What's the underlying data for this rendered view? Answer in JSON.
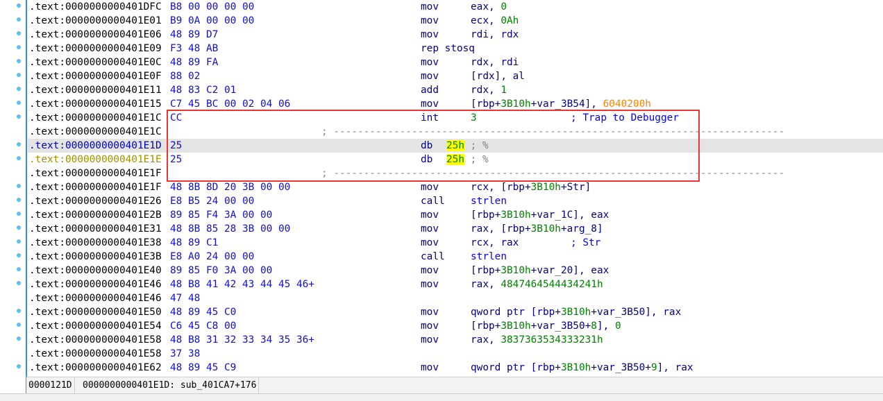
{
  "rows": [
    {
      "addr": ".text:0000000000401DFC",
      "bytes": "B8 00 00 00 00",
      "mn": "mov",
      "ops": [
        [
          "eax, ",
          "reg"
        ],
        [
          "0",
          "num"
        ]
      ],
      "bullet": true
    },
    {
      "addr": ".text:0000000000401E01",
      "bytes": "B9 0A 00 00 00",
      "mn": "mov",
      "ops": [
        [
          "ecx, ",
          "reg"
        ],
        [
          "0Ah",
          "num"
        ]
      ],
      "bullet": true
    },
    {
      "addr": ".text:0000000000401E06",
      "bytes": "48 89 D7",
      "mn": "mov",
      "ops": [
        [
          "rdi, rdx",
          "reg"
        ]
      ],
      "bullet": true
    },
    {
      "addr": ".text:0000000000401E09",
      "bytes": "F3 48 AB",
      "mn": "rep stosq",
      "ops": [],
      "bullet": true
    },
    {
      "addr": ".text:0000000000401E0C",
      "bytes": "48 89 FA",
      "mn": "mov",
      "ops": [
        [
          "rdx, rdi",
          "reg"
        ]
      ],
      "bullet": true
    },
    {
      "addr": ".text:0000000000401E0F",
      "bytes": "88 02",
      "mn": "mov",
      "ops": [
        [
          "[rdx], al",
          "reg"
        ]
      ],
      "bullet": true
    },
    {
      "addr": ".text:0000000000401E11",
      "bytes": "48 83 C2 01",
      "mn": "add",
      "ops": [
        [
          "rdx, ",
          "reg"
        ],
        [
          "1",
          "num"
        ]
      ],
      "bullet": true
    },
    {
      "addr": ".text:0000000000401E15",
      "bytes": "C7 45 BC 00 02 04 06",
      "mn": "mov",
      "ops": [
        [
          "[rbp+",
          "reg"
        ],
        [
          "3B10h",
          "num"
        ],
        [
          "+var_3B54], ",
          "reg"
        ],
        [
          "6040200h",
          "orange"
        ]
      ],
      "bullet": true
    },
    {
      "addr": ".text:0000000000401E1C",
      "bytes": "CC",
      "mn": "int",
      "ops": [
        [
          "3",
          "num"
        ]
      ],
      "comment": "; Trap to Debugger",
      "bullet": true
    },
    {
      "addr": ".text:0000000000401E1C",
      "sep": true
    },
    {
      "addr": ".text:0000000000401E1D",
      "bytes": "25",
      "db": "25h",
      "dbcmt": "; %",
      "bullet": true,
      "selected": true,
      "addrColor": "blue"
    },
    {
      "addr": ".text:0000000000401E1E",
      "bytes": "25",
      "db": "25h",
      "dbcmt": "; %",
      "bullet": true,
      "addrColor": "olive"
    },
    {
      "addr": ".text:0000000000401E1F",
      "sep": true
    },
    {
      "addr": ".text:0000000000401E1F",
      "bytes": "48 8B 8D 20 3B 00 00",
      "mn": "mov",
      "ops": [
        [
          "rcx, [rbp+",
          "reg"
        ],
        [
          "3B10h",
          "num"
        ],
        [
          "+Str]",
          "reg"
        ]
      ],
      "bullet": true
    },
    {
      "addr": ".text:0000000000401E26",
      "bytes": "E8 B5 24 00 00",
      "mn": "call",
      "ops": [
        [
          "strlen",
          "name"
        ]
      ],
      "bullet": true
    },
    {
      "addr": ".text:0000000000401E2B",
      "bytes": "89 85 F4 3A 00 00",
      "mn": "mov",
      "ops": [
        [
          "[rbp+",
          "reg"
        ],
        [
          "3B10h",
          "num"
        ],
        [
          "+var_1C], eax",
          "reg"
        ]
      ],
      "bullet": true
    },
    {
      "addr": ".text:0000000000401E31",
      "bytes": "48 8B 85 28 3B 00 00",
      "mn": "mov",
      "ops": [
        [
          "rax, [rbp+",
          "reg"
        ],
        [
          "3B10h",
          "num"
        ],
        [
          "+arg_8]",
          "reg"
        ]
      ],
      "bullet": true
    },
    {
      "addr": ".text:0000000000401E38",
      "bytes": "48 89 C1",
      "mn": "mov",
      "ops": [
        [
          "rcx, rax",
          "reg"
        ]
      ],
      "comment": "; Str",
      "bullet": true
    },
    {
      "addr": ".text:0000000000401E3B",
      "bytes": "E8 A0 24 00 00",
      "mn": "call",
      "ops": [
        [
          "strlen",
          "name"
        ]
      ],
      "bullet": true
    },
    {
      "addr": ".text:0000000000401E40",
      "bytes": "89 85 F0 3A 00 00",
      "mn": "mov",
      "ops": [
        [
          "[rbp+",
          "reg"
        ],
        [
          "3B10h",
          "num"
        ],
        [
          "+var_20], eax",
          "reg"
        ]
      ],
      "bullet": true
    },
    {
      "addr": ".text:0000000000401E46",
      "bytes": "48 B8 41 42 43 44 45 46+",
      "mn": "mov",
      "ops": [
        [
          "rax, ",
          "reg"
        ],
        [
          "4847464544434241h",
          "num"
        ]
      ],
      "bullet": true
    },
    {
      "addr": ".text:0000000000401E46",
      "bytes": "47 48"
    },
    {
      "addr": ".text:0000000000401E50",
      "bytes": "48 89 45 C0",
      "mn": "mov",
      "ops": [
        [
          "qword ptr [rbp+",
          "reg"
        ],
        [
          "3B10h",
          "num"
        ],
        [
          "+var_3B50], rax",
          "reg"
        ]
      ],
      "bullet": true
    },
    {
      "addr": ".text:0000000000401E54",
      "bytes": "C6 45 C8 00",
      "mn": "mov",
      "ops": [
        [
          "[rbp+",
          "reg"
        ],
        [
          "3B10h",
          "num"
        ],
        [
          "+var_3B50+",
          "reg"
        ],
        [
          "8",
          "num"
        ],
        [
          "], ",
          "reg"
        ],
        [
          "0",
          "num"
        ]
      ],
      "bullet": true
    },
    {
      "addr": ".text:0000000000401E58",
      "bytes": "48 B8 31 32 33 34 35 36+",
      "mn": "mov",
      "ops": [
        [
          "rax, ",
          "reg"
        ],
        [
          "3837363534333231h",
          "num"
        ]
      ],
      "bullet": true
    },
    {
      "addr": ".text:0000000000401E58",
      "bytes": "37 38"
    },
    {
      "addr": ".text:0000000000401E62",
      "bytes": "48 89 45 C9",
      "mn": "mov",
      "ops": [
        [
          "qword ptr [rbp+",
          "reg"
        ],
        [
          "3B10h",
          "num"
        ],
        [
          "+var_3B50+",
          "reg"
        ],
        [
          "9",
          "num"
        ],
        [
          "], rax",
          "reg"
        ]
      ],
      "bullet": true
    }
  ],
  "separator": "; ---------------------------------------------------------------------------",
  "status": {
    "offset": "0000121D",
    "location": "0000000000401E1D: sub_401CA7+176"
  },
  "colors": {
    "highlight_box": "#ee3333",
    "selected_row": "#e4e4e4",
    "search_highlight": "#ffff00"
  }
}
